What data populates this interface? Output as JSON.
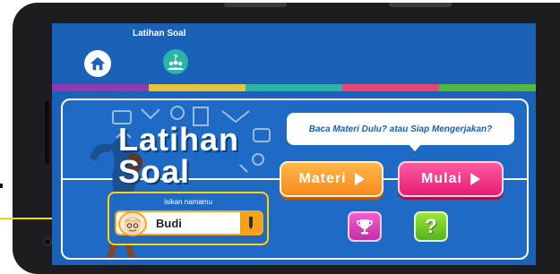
{
  "nav": {
    "title": "Latihan Soal",
    "home_icon": "home-icon",
    "quiz_icon": "quiz-group-icon"
  },
  "stripe_colors": [
    "#8e3bb1",
    "#e8c33a",
    "#2ab5a3",
    "#e8466f",
    "#55b83a"
  ],
  "hero": {
    "title_line1": "Latihan",
    "title_line2": "Soal"
  },
  "speech": {
    "text": "Baca Materi Dulu? atau Siap Mengerjakan?"
  },
  "buttons": {
    "materi_label": "Materi",
    "mulai_label": "Mulai",
    "trophy_icon": "trophy-icon",
    "help_label": "?"
  },
  "name_input": {
    "label": "isikan namamu",
    "value": "Budi",
    "edit_icon": "pencil-icon"
  },
  "colors": {
    "screen_bg": "#1b61b8",
    "materi": "#f68a1f",
    "mulai": "#e51e73",
    "trophy": "#c42ea6",
    "help": "#54b41c",
    "highlight": "#ffd400"
  }
}
